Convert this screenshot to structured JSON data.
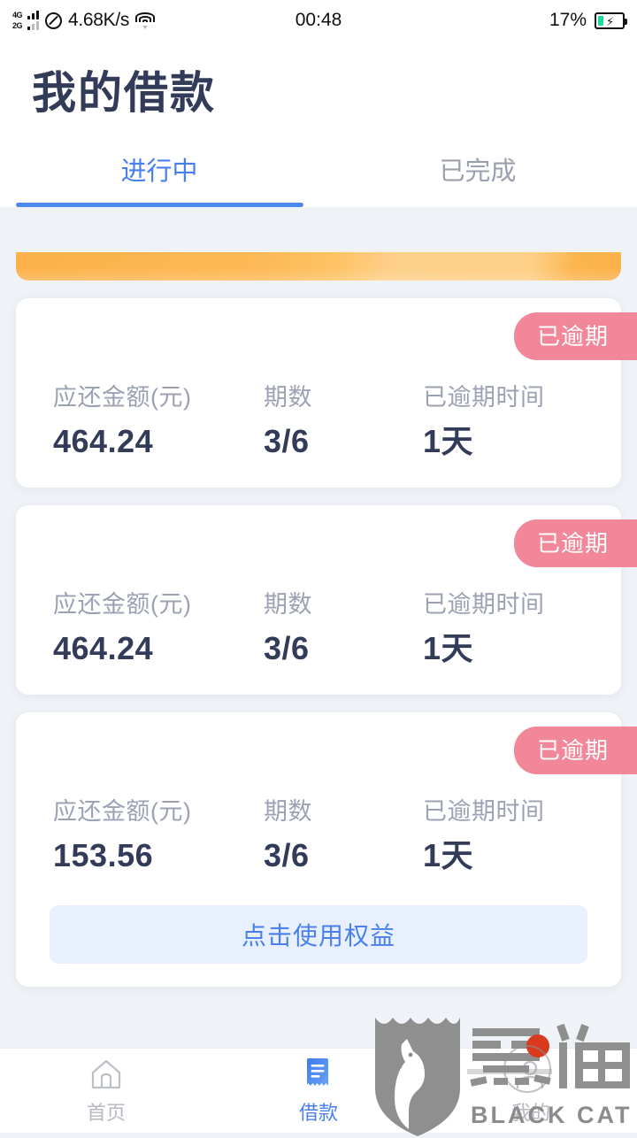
{
  "status_bar": {
    "network_4g": "4G",
    "network_2g": "2G",
    "no_entry_icon": "no-entry-icon",
    "speed": "4.68K/s",
    "wifi_icon": "wifi-icon",
    "time": "00:48",
    "battery_percent": "17%",
    "battery_icon": "battery-charging-icon"
  },
  "header": {
    "title": "我的借款",
    "tabs": [
      {
        "label": "进行中",
        "active": true
      },
      {
        "label": "已完成",
        "active": false
      }
    ]
  },
  "banner": {
    "name": "promo-banner-partial"
  },
  "cards": [
    {
      "badge": "已逾期",
      "stats": [
        {
          "label": "应还金额(元)",
          "value": "464.24"
        },
        {
          "label": "期数",
          "value": "3/6"
        },
        {
          "label": "已逾期时间",
          "value": "1天"
        }
      ],
      "action": null
    },
    {
      "badge": "已逾期",
      "stats": [
        {
          "label": "应还金额(元)",
          "value": "464.24"
        },
        {
          "label": "期数",
          "value": "3/6"
        },
        {
          "label": "已逾期时间",
          "value": "1天"
        }
      ],
      "action": null
    },
    {
      "badge": "已逾期",
      "stats": [
        {
          "label": "应还金额(元)",
          "value": "153.56"
        },
        {
          "label": "期数",
          "value": "3/6"
        },
        {
          "label": "已逾期时间",
          "value": "1天"
        }
      ],
      "action": "点击使用权益"
    }
  ],
  "bottom_nav": [
    {
      "label": "首页",
      "icon": "home-icon",
      "active": false
    },
    {
      "label": "借款",
      "icon": "receipt-icon",
      "active": true
    },
    {
      "label": "我的",
      "icon": "person-icon",
      "active": false
    }
  ],
  "watermark": {
    "brand_cn": "黑猫",
    "brand_en": "BLACK CAT",
    "shield_icon": "shield-cat-logo"
  },
  "colors": {
    "accent_blue": "#4a80ee",
    "overdue_pink": "#f2879a",
    "title_navy": "#323b58",
    "label_gray": "#9ca2b3",
    "page_bg": "#eff2f6",
    "banner_orange": "#fcb14a"
  }
}
